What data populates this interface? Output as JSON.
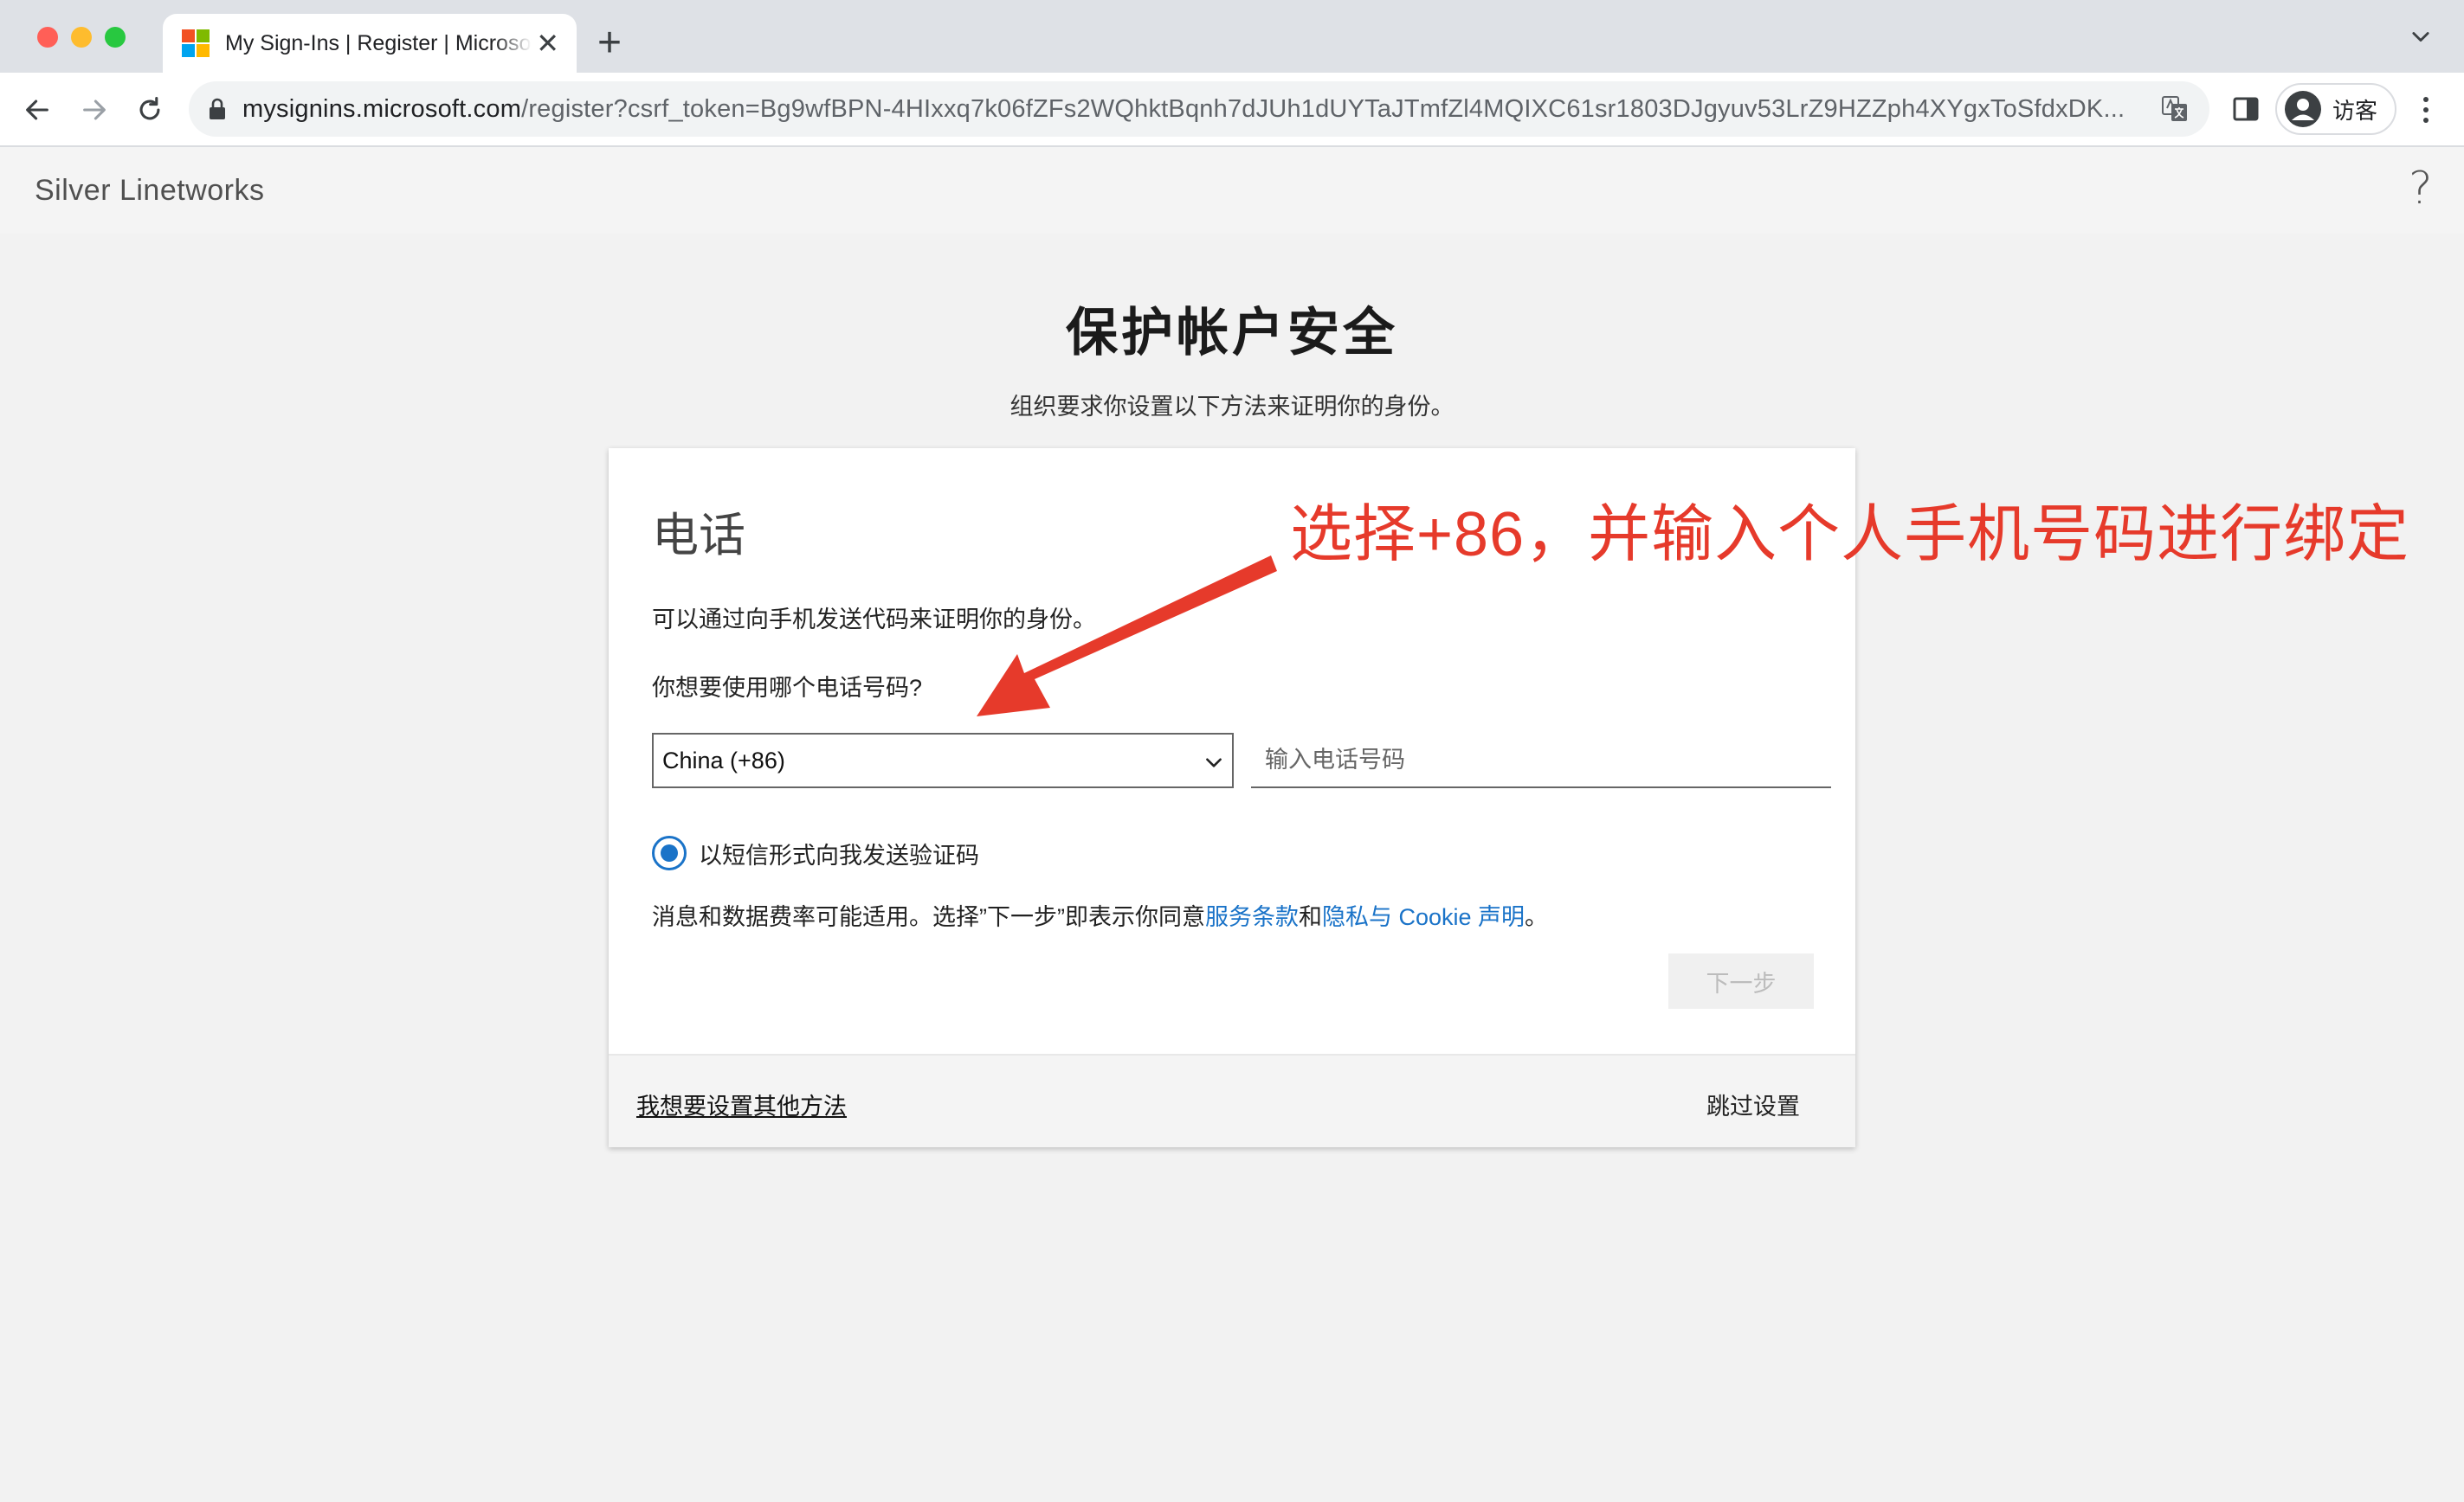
{
  "browser": {
    "tab": {
      "title": "My Sign-Ins | Register | Microsoft",
      "favicon": "microsoft-logo-icon",
      "favicon_colors": [
        "#f25022",
        "#7fba00",
        "#00a4ef",
        "#ffb900"
      ]
    },
    "new_tab_label": "+",
    "close_tab_label": "✕",
    "url_host": "mysignins.microsoft.com",
    "url_path": "/register?csrf_token=Bg9wfBPN-4HIxxq7k06fZFs2WQhktBqnh7dJUh1dUYTaJTmfZl4MQIXC61sr1803DJgyuv53LrZ9HZZph4XYgxToSfdxDK...",
    "profile_label": "访客"
  },
  "header": {
    "org_name": "Silver Linetworks",
    "help_label": "?"
  },
  "main": {
    "title": "保护帐户安全",
    "subtitle": "组织要求你设置以下方法来证明你的身份。"
  },
  "card": {
    "title": "电话",
    "description": "可以通过向手机发送代码来证明你的身份。",
    "question": "你想要使用哪个电话号码?",
    "country_value": "China (+86)",
    "phone_placeholder": "输入电话号码",
    "radio_label": "以短信形式向我发送验证码",
    "consent_prefix": "消息和数据费率可能适用。选择”下一步”即表示你同意",
    "terms_link": "服务条款",
    "consent_and": "和",
    "privacy_link": "隐私与 Cookie 声明",
    "consent_suffix": "。",
    "next_label": "下一步",
    "footer_other_method": "我想要设置其他方法",
    "footer_skip": "跳过设置"
  },
  "annotation": {
    "text": "选择+86，并输入个人手机号码进行绑定",
    "color": "#e63a2b"
  },
  "colors": {
    "link": "#1a73c8",
    "accent": "#1a73c8"
  }
}
